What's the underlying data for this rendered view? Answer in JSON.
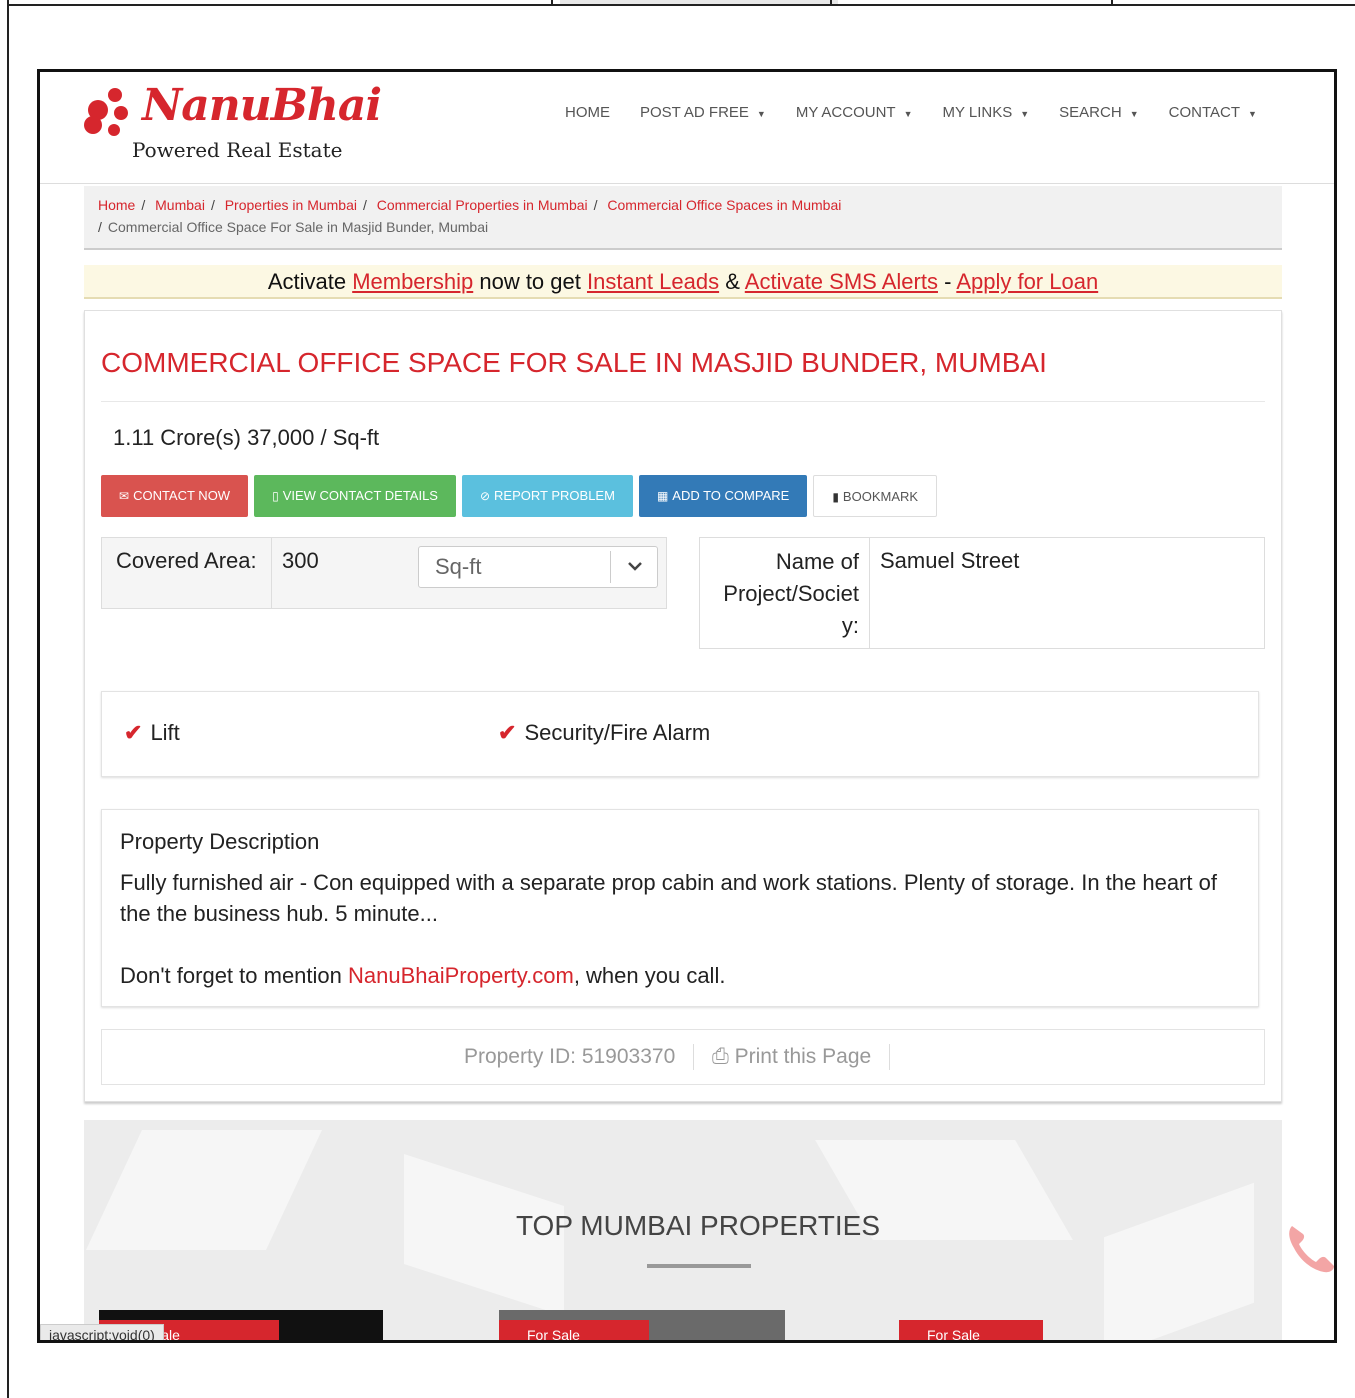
{
  "header": {
    "logo_text": "NanuBhai",
    "logo_tagline": "Powered Real Estate",
    "nav": [
      {
        "label": "HOME",
        "has_caret": false
      },
      {
        "label": "POST AD FREE",
        "has_caret": true
      },
      {
        "label": "MY ACCOUNT",
        "has_caret": true
      },
      {
        "label": "MY LINKS",
        "has_caret": true
      },
      {
        "label": "SEARCH",
        "has_caret": true
      },
      {
        "label": "CONTACT",
        "has_caret": true
      }
    ]
  },
  "breadcrumb": {
    "links": [
      "Home",
      "Mumbai",
      "Properties in Mumbai",
      "Commercial Properties in Mumbai",
      "Commercial Office Spaces in Mumbai"
    ],
    "current": "Commercial Office Space For Sale in Masjid Bunder, Mumbai",
    "separator": "/"
  },
  "alert": {
    "t1": "Activate ",
    "link1": "Membership",
    "t2": " now to get ",
    "link2": "Instant Leads",
    "t3": " & ",
    "link3": "Activate SMS Alerts",
    "t4": " - ",
    "link4": "Apply for Loan"
  },
  "property": {
    "title": "COMMERCIAL OFFICE SPACE FOR SALE IN MASJID BUNDER, MUMBAI",
    "price": "1.11 Crore(s) 37,000 / Sq-ft",
    "buttons": {
      "contact": "CONTACT NOW",
      "view_contact": "VIEW CONTACT DETAILS",
      "report": "REPORT PROBLEM",
      "compare": "ADD TO COMPARE",
      "bookmark": "BOOKMARK"
    },
    "covered_area": {
      "label": "Covered Area:",
      "value": "300",
      "unit": "Sq-ft"
    },
    "project": {
      "label_line1": "Name of",
      "label_line2": "Project/Societ",
      "label_line3": "y:",
      "value": "Samuel Street"
    },
    "amenities": [
      "Lift",
      "Security/Fire Alarm"
    ],
    "description": {
      "title": "Property Description",
      "text": "Fully furnished air - Con equipped with a separate prop cabin and work stations. Plenty of storage. In the heart of the the business hub. 5 minute...",
      "mention_pre": "Don't forget to mention ",
      "mention_link": "NanuBhaiProperty.com",
      "mention_post": ", when you call."
    },
    "property_id": "Property ID: 51903370",
    "print_label": "Print this Page"
  },
  "top_properties": {
    "title": "TOP MUMBAI PROPERTIES",
    "card_tags": [
      "For Sale",
      "For Sale",
      "For Sale"
    ]
  },
  "status_bar": "javascript:void(0)",
  "colors": {
    "brand_red": "#d6262d",
    "btn_red": "#d9534f",
    "btn_green": "#5cb85c",
    "btn_cyan": "#5bc0de",
    "btn_blue": "#337ab7",
    "alert_bg": "#fcf8e3"
  },
  "icons": {
    "contact": "envelope-icon",
    "view_contact": "mobile-icon",
    "report": "ban-icon",
    "compare": "table-icon",
    "bookmark": "bookmark-icon",
    "amenity": "check-icon",
    "print": "print-icon",
    "floating": "phone-icon"
  }
}
